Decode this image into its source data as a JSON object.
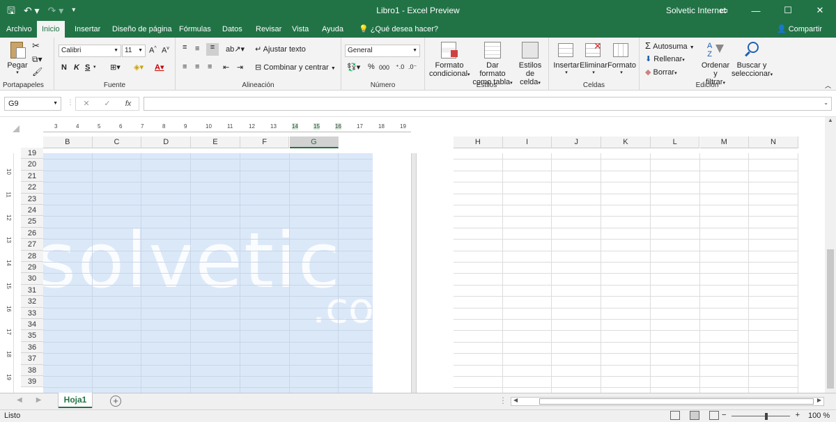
{
  "window": {
    "title": "Libro1  -  Excel Preview",
    "user": "Solvetic Internet",
    "share_label": "Compartir",
    "quick_access_icons": [
      "save-icon",
      "undo-icon",
      "redo-icon",
      "customize-icon"
    ]
  },
  "tabs": [
    {
      "label": "Archivo",
      "active": false
    },
    {
      "label": "Inicio",
      "active": true
    },
    {
      "label": "Insertar",
      "active": false
    },
    {
      "label": "Diseño de página",
      "active": false
    },
    {
      "label": "Fórmulas",
      "active": false
    },
    {
      "label": "Datos",
      "active": false
    },
    {
      "label": "Revisar",
      "active": false
    },
    {
      "label": "Vista",
      "active": false
    },
    {
      "label": "Ayuda",
      "active": false
    }
  ],
  "tell_me": "¿Qué desea hacer?",
  "ribbon": {
    "clipboard": {
      "label": "Portapapeles",
      "paste": "Pegar"
    },
    "font": {
      "label": "Fuente",
      "name": "Calibri",
      "size": "11",
      "bold": "N",
      "italic": "K",
      "underline": "S"
    },
    "alignment": {
      "label": "Alineación",
      "wrap": "Ajustar texto",
      "merge": "Combinar y centrar"
    },
    "number": {
      "label": "Número",
      "format": "General",
      "percent": "%",
      "thousands": "000"
    },
    "styles": {
      "label": "Estilos",
      "conditional_1": "Formato",
      "conditional_2": "condicional",
      "table_1": "Dar formato",
      "table_2": "como tabla",
      "cell_1": "Estilos de",
      "cell_2": "celda"
    },
    "cells": {
      "label": "Celdas",
      "insert": "Insertar",
      "delete": "Eliminar",
      "format": "Formato"
    },
    "editing": {
      "label": "Edición",
      "autosum": "Autosuma",
      "fill": "Rellenar",
      "clear": "Borrar",
      "sort_1": "Ordenar y",
      "sort_2": "filtrar",
      "find_1": "Buscar y",
      "find_2": "seleccionar"
    }
  },
  "formula_bar": {
    "name_box": "G9",
    "fx": "fx",
    "value": ""
  },
  "ruler_h": [
    "3",
    "4",
    "5",
    "6",
    "7",
    "8",
    "9",
    "10",
    "11",
    "12",
    "13",
    "14",
    "15",
    "16",
    "17",
    "18",
    "19"
  ],
  "ruler_v": [
    "10",
    "11",
    "12",
    "13",
    "14",
    "15",
    "16",
    "17",
    "18",
    "19"
  ],
  "columns_page1": [
    "B",
    "C",
    "D",
    "E",
    "F",
    "G"
  ],
  "columns_page2": [
    "H",
    "I",
    "J",
    "K",
    "L",
    "M",
    "N"
  ],
  "selected_column": "G",
  "rows": [
    "19",
    "20",
    "21",
    "22",
    "23",
    "24",
    "25",
    "26",
    "27",
    "28",
    "29",
    "30",
    "31",
    "32",
    "33",
    "34",
    "35",
    "36",
    "37",
    "38",
    "39"
  ],
  "watermark": {
    "main": "solvetic",
    "suffix": ".co"
  },
  "sheet_tabs": [
    {
      "label": "Hoja1",
      "active": true
    }
  ],
  "status": {
    "ready": "Listo",
    "zoom": "100 %"
  }
}
